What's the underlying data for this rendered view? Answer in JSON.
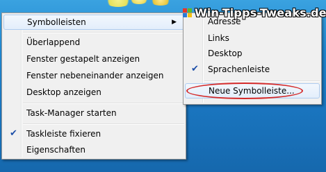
{
  "main_menu": {
    "items": [
      {
        "label": "Symbolleisten",
        "checked": false,
        "submenu": true,
        "highlighted": true
      },
      {
        "label": "Überlappend",
        "checked": false
      },
      {
        "label": "Fenster gestapelt anzeigen",
        "checked": false
      },
      {
        "label": "Fenster nebeneinander anzeigen",
        "checked": false
      },
      {
        "label": "Desktop anzeigen",
        "checked": false
      },
      {
        "label": "Task-Manager starten",
        "checked": false
      },
      {
        "label": "Taskleiste fixieren",
        "checked": true
      },
      {
        "label": "Eigenschaften",
        "checked": false
      }
    ]
  },
  "sub_menu": {
    "items": [
      {
        "label": "Adresse",
        "checked": false
      },
      {
        "label": "Links",
        "checked": false
      },
      {
        "label": "Desktop",
        "checked": false
      },
      {
        "label": "Sprachenleiste",
        "checked": true
      },
      {
        "label": "Neue Symbolleiste...",
        "checked": false,
        "highlighted": true
      }
    ]
  },
  "watermark": {
    "text": "Win-Tipps-Tweaks.de"
  },
  "icons": {
    "submenu_arrow": "chevron-right-icon",
    "check": "check-icon",
    "logo": "windows-logo-icon"
  },
  "colors": {
    "highlight_border": "#aeccef",
    "annotation_ellipse": "#d42a2a",
    "check": "#1c4ea8"
  }
}
